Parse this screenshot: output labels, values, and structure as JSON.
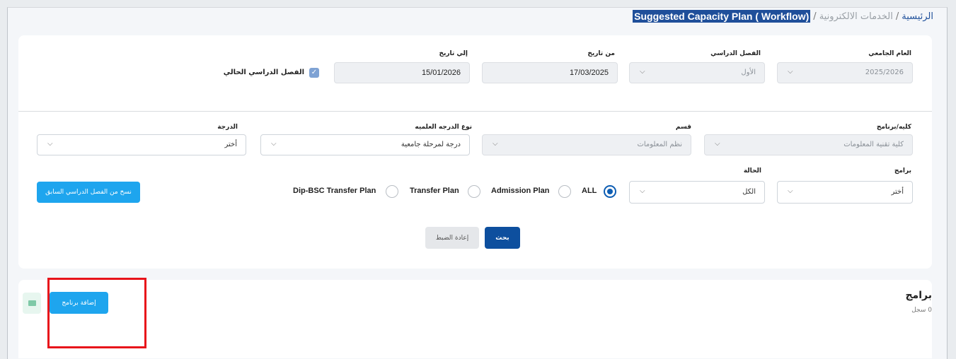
{
  "breadcrumb": {
    "home": "الرئيسية",
    "sep": "/",
    "services": "الخدمات الالكترونية",
    "current": "Suggested Capacity Plan ( Workflow)"
  },
  "filters": {
    "academic_year": {
      "label": "العام الجامعي",
      "value": "2025/2026"
    },
    "semester": {
      "label": "الفصل الدراسي",
      "value": "الأول"
    },
    "from_date": {
      "label": "من تاريخ",
      "value": "17/03/2025"
    },
    "to_date": {
      "label": "إلي تاريخ",
      "value": "15/01/2026"
    },
    "current_semester": {
      "label": "الفصل الدراسي الحالي",
      "checked": true
    },
    "college": {
      "label": "كليه/برنامج",
      "value": "كلية تقنية المعلومات"
    },
    "department": {
      "label": "قسم",
      "value": "نظم المعلومات"
    },
    "degree_type": {
      "label": "نوع الدرجه العلميه",
      "value": "درجة لمرحلة جامعية"
    },
    "degree": {
      "label": "الدرجة",
      "value": "أختر"
    },
    "programs": {
      "label": "برامج",
      "value": "أختر"
    },
    "status": {
      "label": "الحالة",
      "value": "الكل"
    }
  },
  "plan_types": {
    "all": "ALL",
    "admission": "Admission Plan",
    "transfer": "Transfer Plan",
    "dip_bsc": "Dip-BSC Transfer Plan",
    "selected": "ALL"
  },
  "buttons": {
    "copy_previous": "نسخ من الفصل الدراسي السابق",
    "search": "بحث",
    "reset": "إعادة الضبط",
    "add_program": "إضافة برنامج"
  },
  "programs_section": {
    "title": "برامج",
    "count": "0 سجل"
  },
  "icons": {
    "chevron": "chevron-down-icon",
    "check": "check-icon",
    "excel": "excel-export-icon"
  },
  "colors": {
    "primary": "#0d4f9e",
    "accent": "#1ea5ee",
    "highlight": "#e8141b"
  }
}
